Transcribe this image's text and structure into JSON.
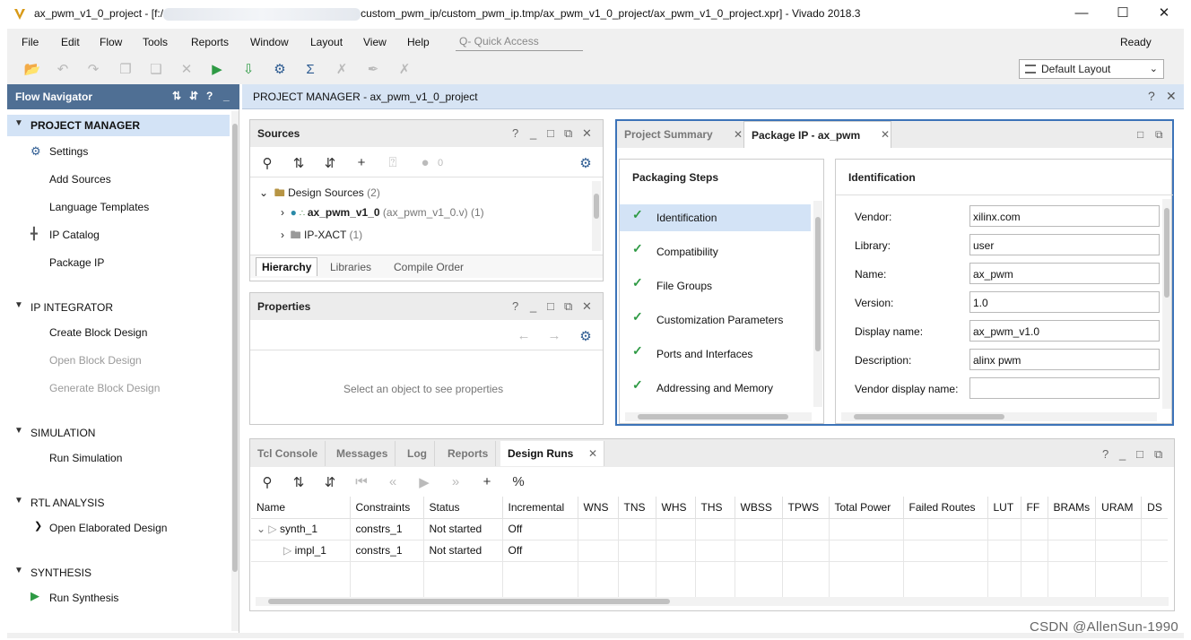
{
  "window": {
    "title_left": "ax_pwm_v1_0_project - [f:/",
    "title_right": "custom_pwm_ip/custom_pwm_ip.tmp/ax_pwm_v1_0_project/ax_pwm_v1_0_project.xpr] - Vivado 2018.3",
    "minimize": "—",
    "maximize": "☐",
    "close": "✕"
  },
  "menu": {
    "items": [
      "File",
      "Edit",
      "Flow",
      "Tools",
      "Reports",
      "Window",
      "Layout",
      "View",
      "Help"
    ],
    "quick_access": "Q- Quick Access",
    "status": "Ready"
  },
  "layout": {
    "selected": "Default Layout"
  },
  "nav": {
    "title": "Flow Navigator",
    "pm": {
      "label": "PROJECT MANAGER",
      "settings": "Settings",
      "add_sources": "Add Sources",
      "lang_templates": "Language Templates",
      "ip_catalog": "IP Catalog",
      "package_ip": "Package IP"
    },
    "ipi": {
      "label": "IP INTEGRATOR",
      "create": "Create Block Design",
      "open": "Open Block Design",
      "generate": "Generate Block Design"
    },
    "sim": {
      "label": "SIMULATION",
      "run": "Run Simulation"
    },
    "rtl": {
      "label": "RTL ANALYSIS",
      "open": "Open Elaborated Design"
    },
    "syn": {
      "label": "SYNTHESIS",
      "run": "Run Synthesis"
    }
  },
  "pm_header": {
    "title": "PROJECT MANAGER - ax_pwm_v1_0_project"
  },
  "sources": {
    "title": "Sources",
    "count_badge": "0",
    "design_sources": "Design Sources",
    "design_sources_count": "(2)",
    "top_module": "ax_pwm_v1_0",
    "top_file": "(ax_pwm_v1_0.v) (1)",
    "ipxact": "IP-XACT",
    "ipxact_count": "(1)",
    "tabs": [
      "Hierarchy",
      "Libraries",
      "Compile Order"
    ]
  },
  "properties": {
    "title": "Properties",
    "empty_msg": "Select an object to see properties"
  },
  "pkg": {
    "tab_summary": "Project Summary",
    "tab_pkg": "Package IP - ax_pwm",
    "steps_title": "Packaging Steps",
    "steps": [
      "Identification",
      "Compatibility",
      "File Groups",
      "Customization Parameters",
      "Ports and Interfaces",
      "Addressing and Memory"
    ],
    "ident_title": "Identification",
    "fields": [
      {
        "label": "Vendor:",
        "value": "xilinx.com"
      },
      {
        "label": "Library:",
        "value": "user"
      },
      {
        "label": "Name:",
        "value": "ax_pwm"
      },
      {
        "label": "Version:",
        "value": "1.0"
      },
      {
        "label": "Display name:",
        "value": "ax_pwm_v1.0"
      },
      {
        "label": "Description:",
        "value": "alinx pwm"
      },
      {
        "label": "Vendor display name:",
        "value": ""
      }
    ]
  },
  "bottom": {
    "tabs": [
      "Tcl Console",
      "Messages",
      "Log",
      "Reports",
      "Design Runs"
    ],
    "columns": [
      "Name",
      "Constraints",
      "Status",
      "Incremental",
      "WNS",
      "TNS",
      "WHS",
      "THS",
      "WBSS",
      "TPWS",
      "Total Power",
      "Failed Routes",
      "LUT",
      "FF",
      "BRAMs",
      "URAM",
      "DS"
    ],
    "rows": [
      {
        "name": "synth_1",
        "constraints": "constrs_1",
        "status": "Not started",
        "incremental": "Off"
      },
      {
        "name": "impl_1",
        "constraints": "constrs_1",
        "status": "Not started",
        "incremental": "Off"
      }
    ]
  },
  "watermark": "CSDN @AllenSun-1990",
  "icons": {
    "app": "vivado-logo-icon",
    "run": "play-icon",
    "sigma": "sigma-icon",
    "gear": "gear-icon"
  }
}
